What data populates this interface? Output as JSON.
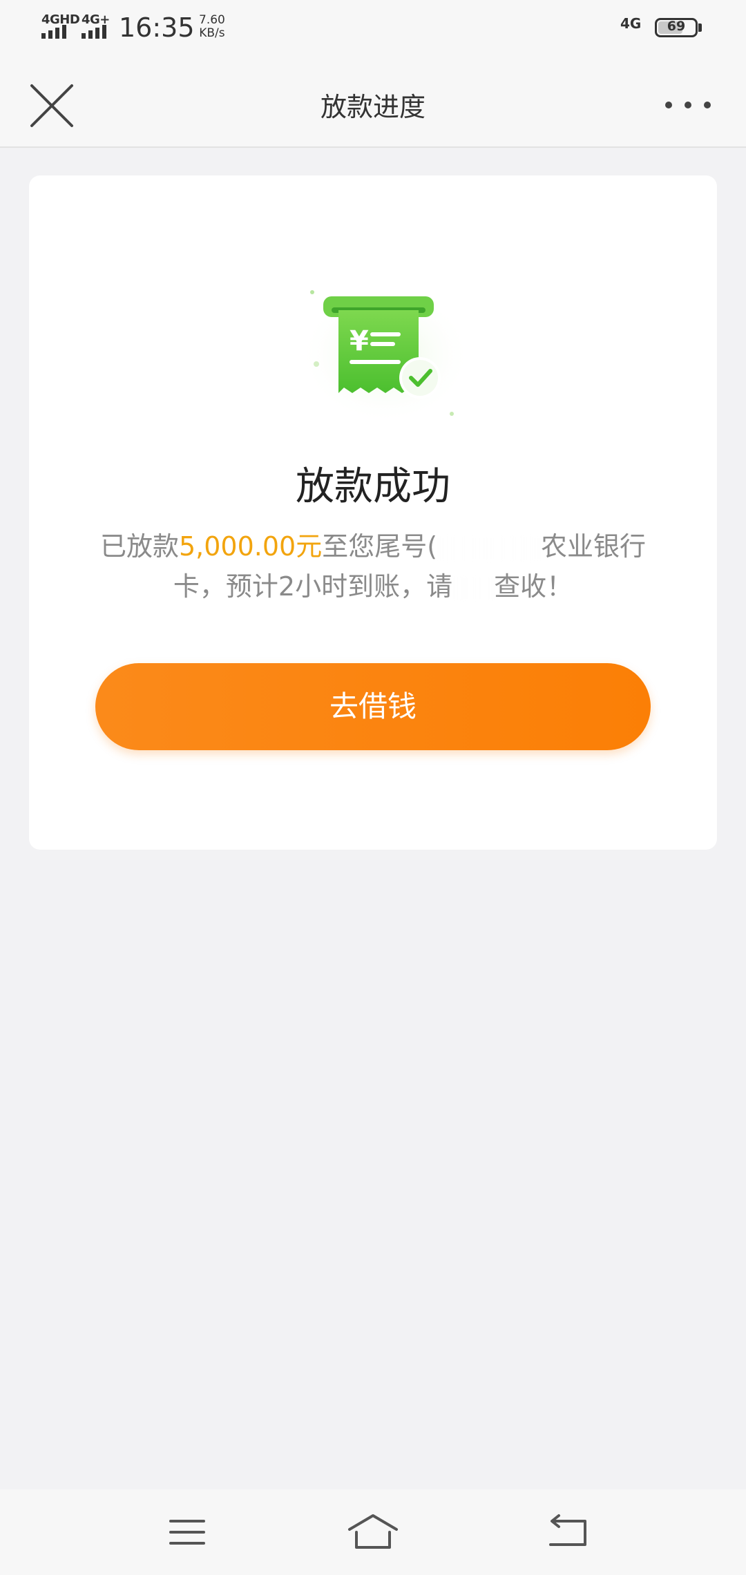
{
  "status_bar": {
    "network_1": "4GHD",
    "network_2": "4G+",
    "time": "16:35",
    "speed_value": "7.60",
    "speed_unit": "KB/s",
    "network_right": "4G",
    "battery": "69",
    "battery_level_percent": 69
  },
  "nav": {
    "close_icon": "close-icon",
    "title": "放款进度",
    "more_icon": "more-dots-icon"
  },
  "card": {
    "illustration_icon": "receipt-check-icon",
    "title": "放款成功",
    "desc_prefix": "已放款",
    "amount": "5,000.00元",
    "desc_mid": "至您尾号(",
    "desc_suffix_line1": "农业银行",
    "desc_line2_a": "卡，预计2小时到账，请",
    "desc_line2_b": "查收！",
    "cta_label": "去借钱"
  },
  "bottom_nav": {
    "menu_icon": "menu-icon",
    "home_icon": "home-icon",
    "back_icon": "back-icon"
  },
  "colors": {
    "accent_orange": "#fb8a1a",
    "amount_color": "#f2a40e",
    "success_green": "#5cc63a"
  }
}
